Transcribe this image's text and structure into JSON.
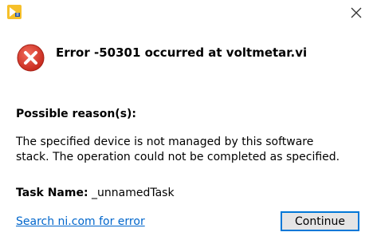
{
  "window": {
    "close_icon": "close-icon",
    "app_icon": "labview-app-icon"
  },
  "error": {
    "icon": "error-x-icon",
    "title": "Error -50301 occurred at voltmetar.vi"
  },
  "reason": {
    "heading": "Possible reason(s):",
    "line1": "The specified device is not managed by this software",
    "line2": "stack. The operation could not be completed as specified."
  },
  "task": {
    "label": "Task Name:",
    "value": " _unnamedTask"
  },
  "actions": {
    "search_link": "Search ni.com for error",
    "continue_label": "Continue"
  },
  "colors": {
    "error_red": "#d9352a",
    "link_blue": "#0066cc",
    "focus_border": "#0078d7"
  }
}
